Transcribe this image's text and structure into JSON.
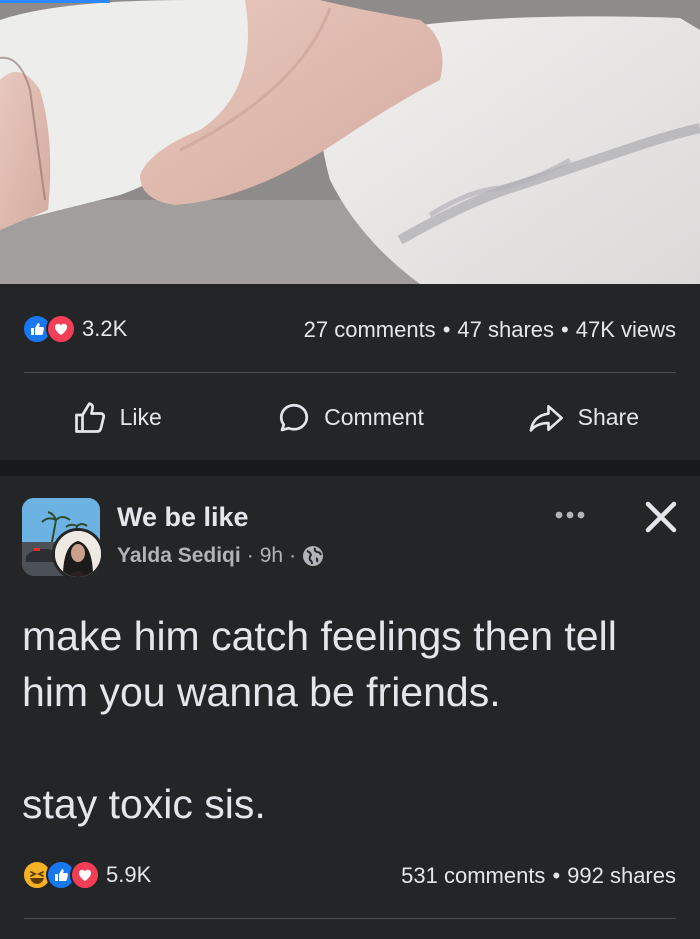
{
  "media": {
    "description_icon": "video-still"
  },
  "post1": {
    "reaction_icons": [
      "like-icon",
      "love-icon"
    ],
    "reaction_count": "3.2K",
    "comments": "27 comments",
    "shares": "47 shares",
    "views": "47K views",
    "separator": "•",
    "actions": {
      "like": "Like",
      "comment": "Comment",
      "share": "Share"
    }
  },
  "post2": {
    "group_name": "We be like",
    "author": "Yalda Sediqi",
    "time": "9h",
    "meta_sep": "·",
    "privacy_icon": "globe-icon",
    "text_line1": "make him catch feelings then tell him you wanna be friends.",
    "text_line2": "stay toxic sis.",
    "reaction_icons": [
      "haha-icon",
      "like-icon",
      "love-icon"
    ],
    "reaction_count": "5.9K",
    "comments": "531 comments",
    "shares": "992 shares",
    "separator": "•"
  },
  "colors": {
    "background": "#242526",
    "band": "#18191a",
    "text": "#e4e6eb",
    "secondary_text": "#b0b3b8",
    "like_blue": "#1877f2",
    "love_red": "#f33e58",
    "haha_yellow": "#f7b125"
  }
}
